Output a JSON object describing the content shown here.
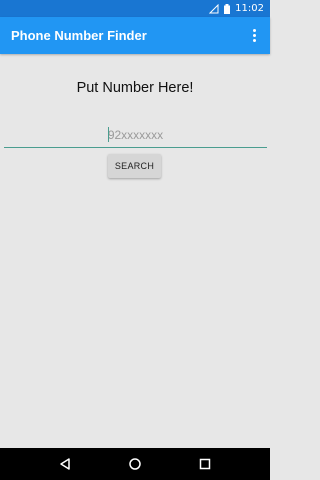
{
  "status_bar": {
    "time": "11:02",
    "icons": [
      "signal-icon",
      "battery-icon"
    ]
  },
  "app_bar": {
    "title": "Phone Number Finder",
    "overflow_icon": "overflow-menu-icon"
  },
  "main": {
    "prompt": "Put Number Here!",
    "number_input": {
      "value": "",
      "placeholder": "92xxxxxxx"
    },
    "search_label": "SEARCH"
  },
  "nav_bar": {
    "icons": [
      "back-icon",
      "home-icon",
      "recents-icon"
    ]
  },
  "colors": {
    "status_bar": "#1976d2",
    "app_bar": "#2196f3",
    "background": "#e7e7e7",
    "input_underline": "#4a9d8f",
    "button": "#d6d6d6"
  }
}
